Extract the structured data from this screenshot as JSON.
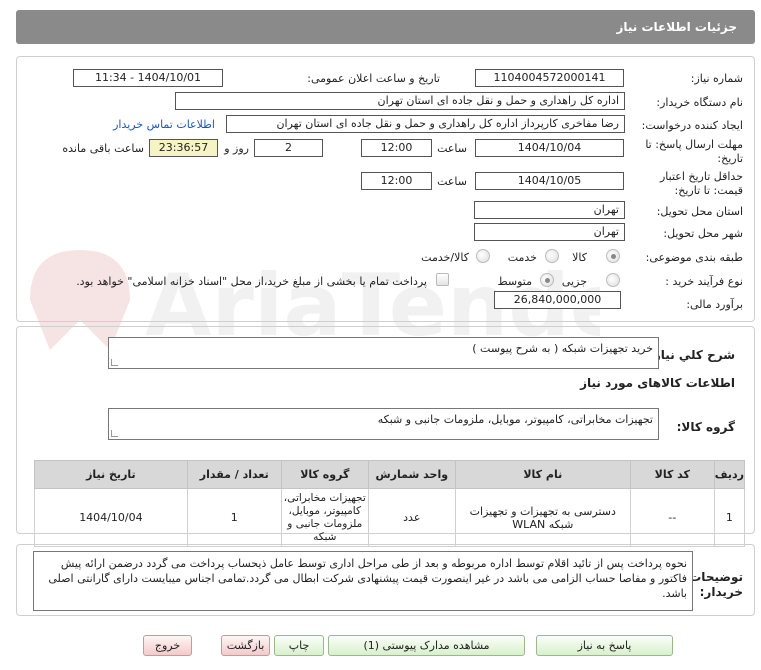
{
  "header": {
    "title": "جزئیات اطلاعات نیاز"
  },
  "fields": {
    "need_number": {
      "label": "شماره نیاز:",
      "value": "1104004572000141"
    },
    "announce_datetime": {
      "label": "تاریخ و ساعت اعلان عمومی:",
      "value": "1404/10/01 - 11:34"
    },
    "buyer_org": {
      "label": "نام دستگاه خریدار:",
      "value": "اداره کل راهداری و حمل و نقل جاده ای استان تهران"
    },
    "requester": {
      "label": "ایجاد کننده درخواست:",
      "value": "رضا مفاخری کارپرداز اداره کل راهداری و حمل و نقل جاده ای استان تهران"
    },
    "buyer_contact_link": "اطلاعات تماس خریدار",
    "reply_deadline": {
      "label_line1": "مهلت ارسال پاسخ: تا",
      "label_line2": "تاریخ:",
      "date": "1404/10/04",
      "time_label": "ساعت",
      "time": "12:00",
      "days": "2",
      "days_label": "روز و",
      "remaining": "23:36:57",
      "remaining_label": "ساعت باقی مانده"
    },
    "price_validity": {
      "label_line1": "حداقل تاریخ اعتبار",
      "label_line2": "قیمت: تا تاریخ:",
      "date": "1404/10/05",
      "time_label": "ساعت",
      "time": "12:00"
    },
    "delivery_province": {
      "label": "استان محل تحویل:",
      "value": "تهران"
    },
    "delivery_city": {
      "label": "شهر محل تحویل:",
      "value": "تهران"
    },
    "category": {
      "label": "طبقه بندی موضوعی:",
      "options": [
        "کالا",
        "خدمت",
        "کالا/خدمت"
      ],
      "selected": "کالا"
    },
    "purchase_type": {
      "label": "نوع فرآیند خرید :",
      "options": [
        "جزیی",
        "متوسط"
      ],
      "selected": "متوسط",
      "payment_note": "پرداخت تمام یا بخشی از مبلغ خرید،از محل \"اسناد خزانه اسلامی\" خواهد بود."
    },
    "estimate": {
      "label": "برآورد مالی:",
      "value": "26,840,000,000"
    }
  },
  "summary": {
    "label": "شرح کلي نياز:",
    "value": "خرید تجهیزات شبکه ( به شرح پیوست )"
  },
  "goods_section": {
    "title": "اطلاعات کالاهای مورد نیاز"
  },
  "goods_group": {
    "label": "گروه کالا:",
    "value": "تجهیزات مخابراتی، کامپیوتر، موبایل، ملزومات جانبی و شبکه"
  },
  "table": {
    "headers": [
      "ردیف",
      "کد کالا",
      "نام کالا",
      "واحد شمارش",
      "گروه کالا",
      "تعداد / مقدار",
      "تاریخ نیاز"
    ],
    "rows": [
      [
        "1",
        "--",
        "دسترسی به تجهیزات و تجهیزات شبکه WLAN",
        "عدد",
        "تجهیزات مخابراتی، کامپیوتر، موبایل، ملزومات جانبی و شبکه",
        "1",
        "1404/10/04"
      ]
    ]
  },
  "buyer_notes": {
    "label_line1": "توضیحات",
    "label_line2": "خریدار:",
    "value": "نحوه پرداخت پس از تائید اقلام توسط اداره مربوطه و بعد از طی مراحل اداری توسط عامل ذیحساب پرداخت می گردد درضمن ارائه پیش فاکتور و مفاصا حساب الزامی می باشد در غیر اینصورت قیمت پیشنهادی شرکت ابطال می گردد.تمامی اجناس میبایست دارای گارانتی اصلی باشد."
  },
  "buttons": {
    "reply": "پاسخ به نیاز",
    "view_docs": "مشاهده مدارک پیوستی (1)",
    "print": "چاپ",
    "back": "بازگشت",
    "exit": "خروج"
  },
  "colors": {
    "header_bg": "#8a8a8a",
    "link": "#1a55c4",
    "remaining_bg": "#f6f3c4"
  }
}
